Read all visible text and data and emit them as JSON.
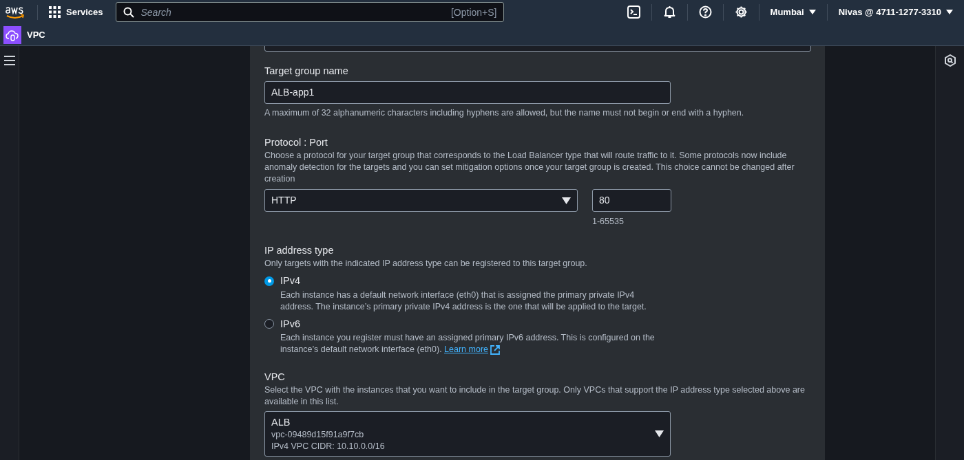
{
  "top_nav": {
    "services": "Services",
    "search": {
      "placeholder": "Search",
      "shortcut": "[Option+S]"
    },
    "region": "Mumbai",
    "account": "Nivas @ 4711-1277-3310"
  },
  "service_bar": {
    "name": "VPC"
  },
  "form": {
    "target_group_name": {
      "label": "Target group name",
      "value": "ALB-app1",
      "hint": "A maximum of 32 alphanumeric characters including hyphens are allowed, but the name must not begin or end with a hyphen."
    },
    "protocol_port": {
      "label": "Protocol : Port",
      "description": "Choose a protocol for your target group that corresponds to the Load Balancer type that will route traffic to it. Some protocols now include anomaly detection for the targets and you can set mitigation options once your target group is created. This choice cannot be changed after creation",
      "protocol": "HTTP",
      "port": "80",
      "port_hint": "1-65535"
    },
    "ip_address_type": {
      "label": "IP address type",
      "description": "Only targets with the indicated IP address type can be registered to this target group.",
      "options": [
        {
          "label": "IPv4",
          "selected": true,
          "description": "Each instance has a default network interface (eth0) that is assigned the primary private IPv4 address. The instance’s primary private IPv4 address is the one that will be applied to the target."
        },
        {
          "label": "IPv6",
          "selected": false,
          "description": "Each instance you register must have an assigned primary IPv6 address. This is configured on the instance’s default network interface (eth0).",
          "link": "Learn more"
        }
      ]
    },
    "vpc": {
      "label": "VPC",
      "description": "Select the VPC with the instances that you want to include in the target group. Only VPCs that support the IP address type selected above are available in this list.",
      "name": "ALB",
      "id": "vpc-09489d15f91a9f7cb",
      "cidr": "IPv4 VPC CIDR: 10.10.0.0/16"
    }
  }
}
